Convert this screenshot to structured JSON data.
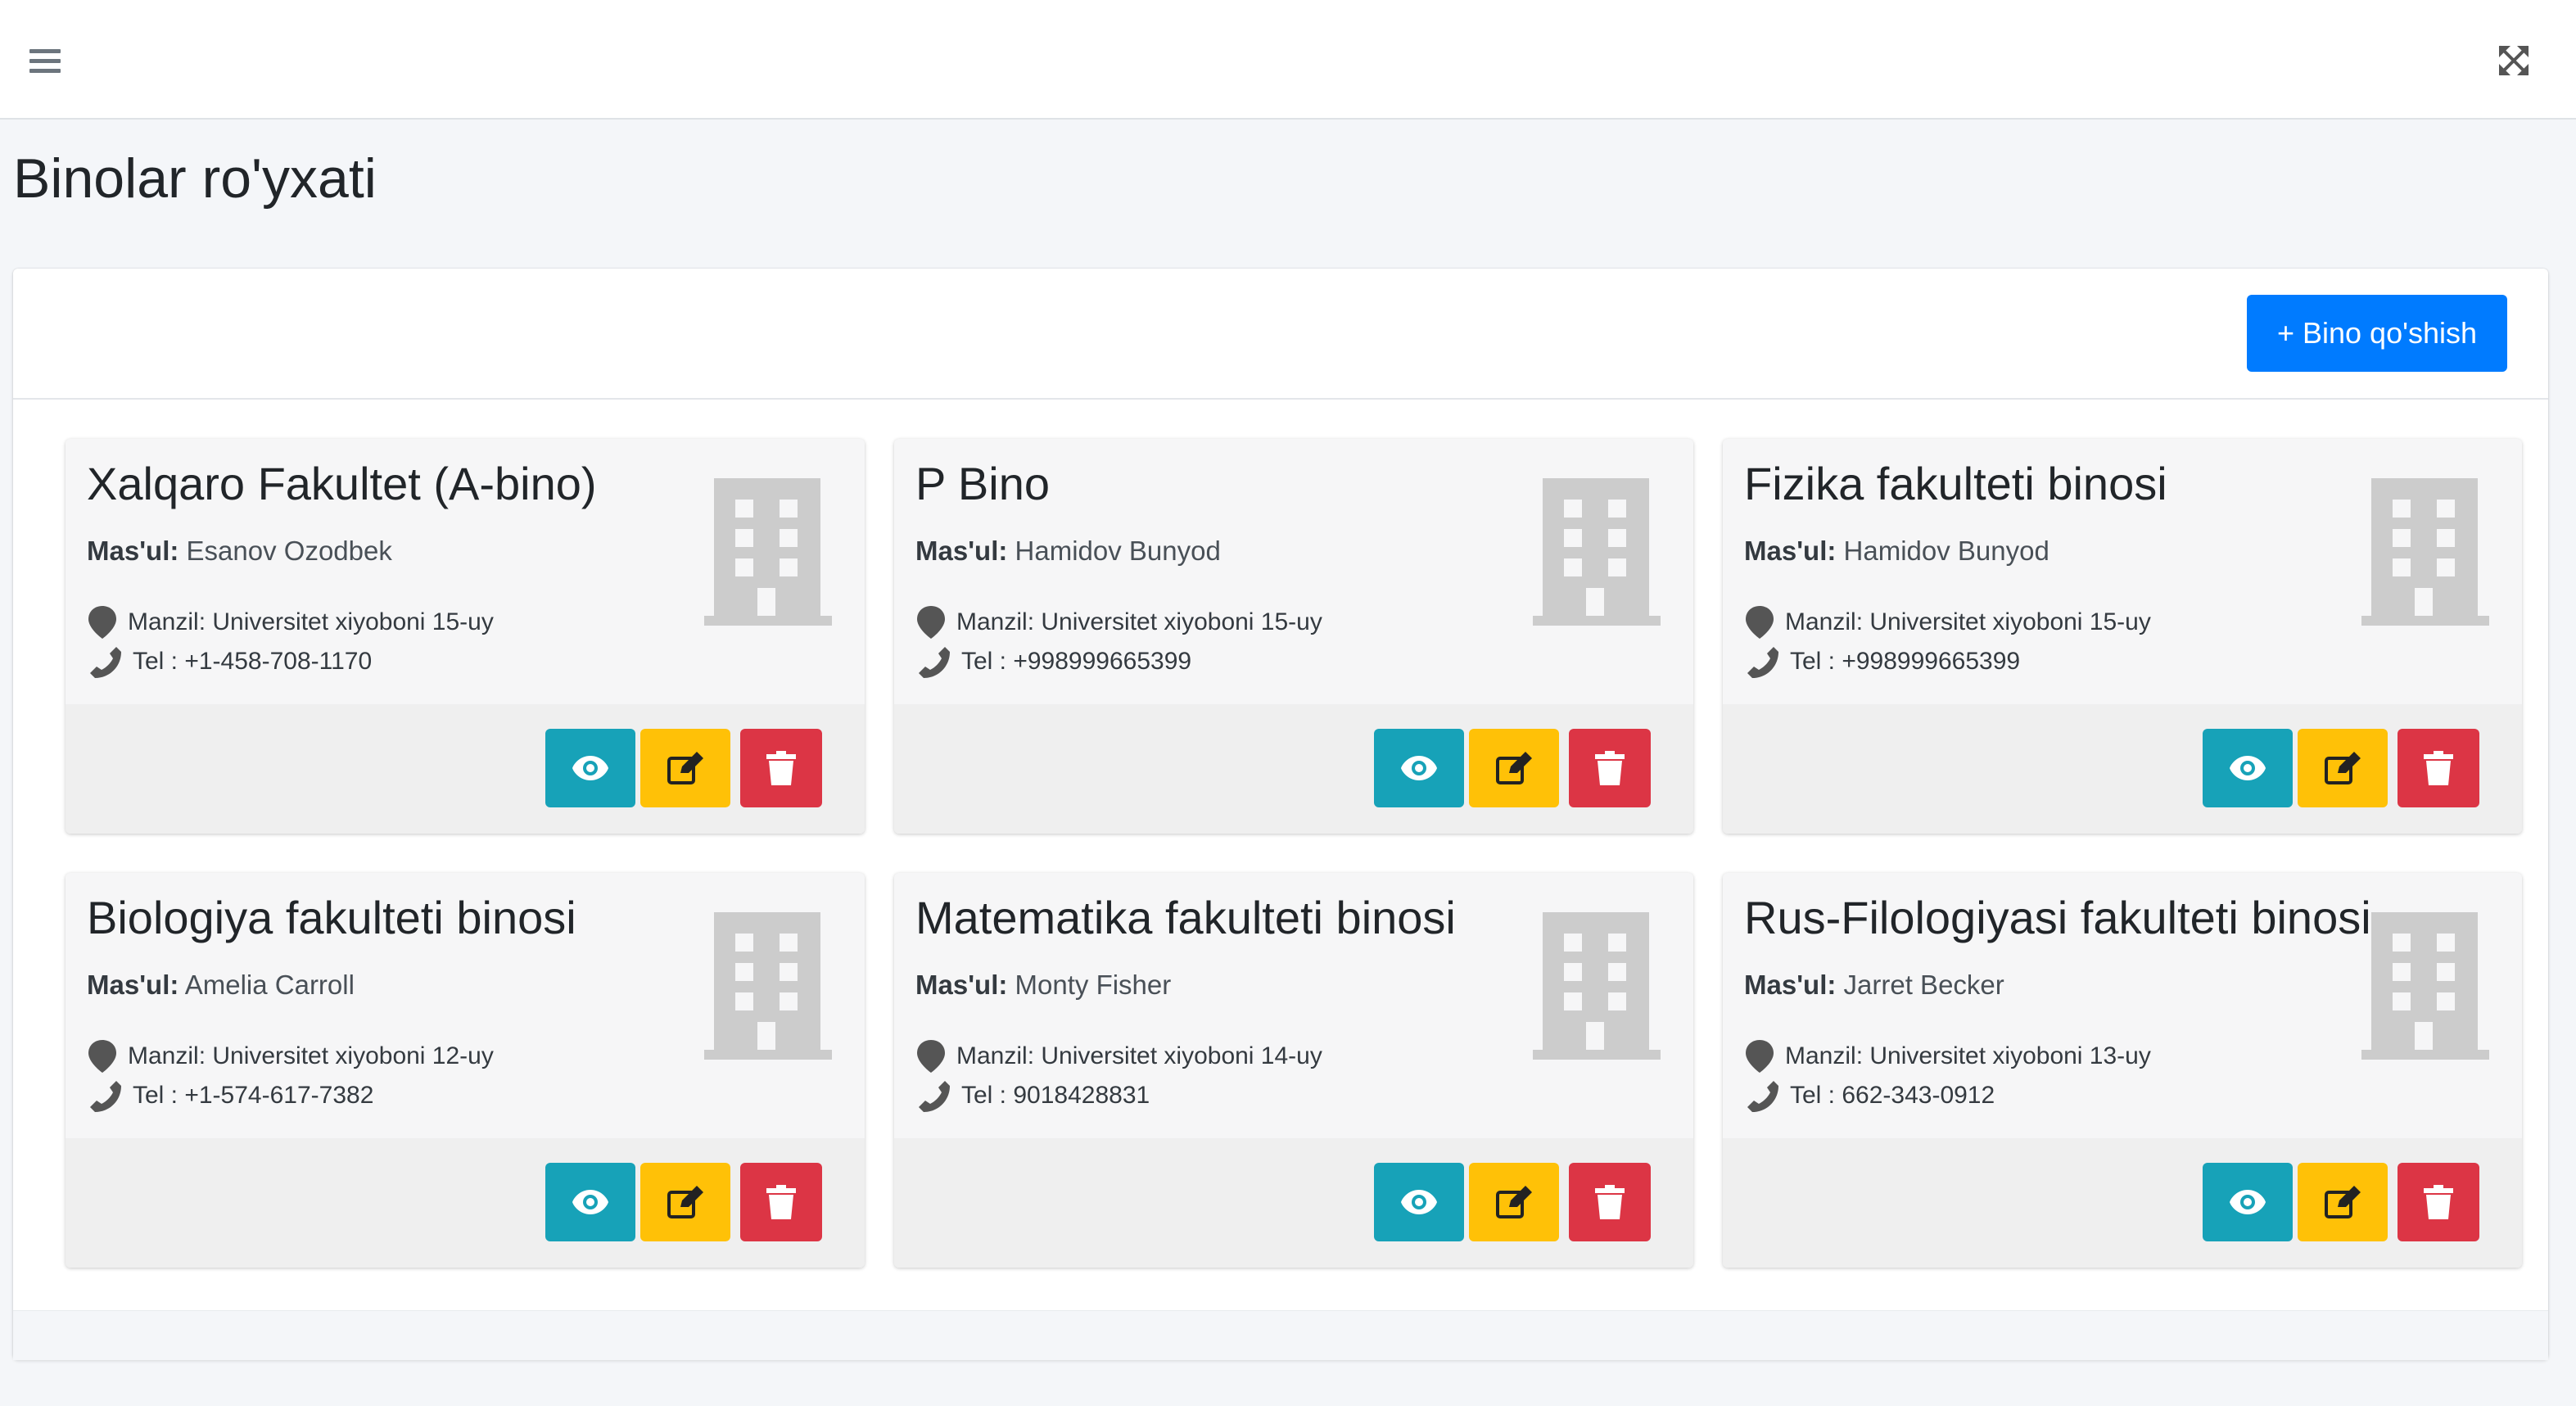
{
  "page": {
    "title": "Binolar ro'yxati",
    "add_button_label": "+ Bino qo'shish"
  },
  "colors": {
    "primary": "#007bff",
    "view": "#17a2b8",
    "edit": "#ffc107",
    "delete": "#dc3545",
    "building_icon": "#cccccc"
  },
  "icons": {
    "menu": "hamburger-icon",
    "fullscreen": "expand-arrows-icon",
    "building": "building-icon",
    "address": "map-marker-icon",
    "phone": "phone-icon",
    "view": "eye-icon",
    "edit": "edit-icon",
    "delete": "trash-icon"
  },
  "buildings": [
    {
      "name": "Xalqaro Fakultet (A-bino)",
      "responsible_label": "Mas'ul:",
      "responsible": "Esanov Ozodbek",
      "address": "Manzil: Universitet xiyoboni 15-uy",
      "phone": "Tel : +1-458-708-1170"
    },
    {
      "name": "P Bino",
      "responsible_label": "Mas'ul:",
      "responsible": "Hamidov Bunyod",
      "address": "Manzil: Universitet xiyoboni 15-uy",
      "phone": "Tel : +998999665399"
    },
    {
      "name": "Fizika fakulteti binosi",
      "responsible_label": "Mas'ul:",
      "responsible": "Hamidov Bunyod",
      "address": "Manzil: Universitet xiyoboni 15-uy",
      "phone": "Tel : +998999665399"
    },
    {
      "name": "Biologiya fakulteti binosi",
      "responsible_label": "Mas'ul:",
      "responsible": "Amelia Carroll",
      "address": "Manzil: Universitet xiyoboni 12-uy",
      "phone": "Tel : +1-574-617-7382"
    },
    {
      "name": "Matematika fakulteti binosi",
      "responsible_label": "Mas'ul:",
      "responsible": "Monty Fisher",
      "address": "Manzil: Universitet xiyoboni 14-uy",
      "phone": "Tel : 9018428831"
    },
    {
      "name": "Rus-Filologiyasi fakulteti binosi",
      "responsible_label": "Mas'ul:",
      "responsible": "Jarret Becker",
      "address": "Manzil: Universitet xiyoboni 13-uy",
      "phone": "Tel : 662-343-0912"
    }
  ]
}
